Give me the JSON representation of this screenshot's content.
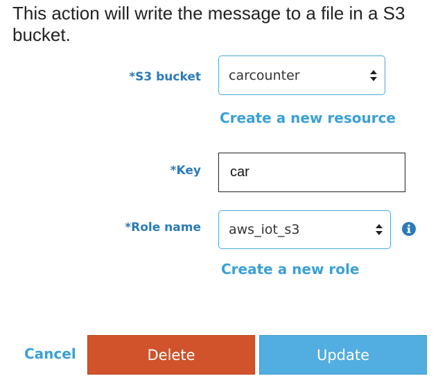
{
  "heading": "This action will write the message to a file in a S3 bucket.",
  "form": {
    "s3_bucket": {
      "label": "*S3 bucket",
      "value": "carcounter",
      "create_link": "Create a new resource"
    },
    "key": {
      "label": "*Key",
      "value": "car"
    },
    "role_name": {
      "label": "*Role name",
      "value": "aws_iot_s3",
      "create_link": "Create a new role"
    }
  },
  "actions": {
    "cancel": "Cancel",
    "delete": "Delete",
    "update": "Update"
  },
  "colors": {
    "label": "#2b7bb9",
    "link": "#3aa0d8",
    "delete_bg": "#d0532b",
    "update_bg": "#52ade0",
    "select_border": "#4aa8d8"
  },
  "icons": {
    "select_arrows": "updown-arrows-icon",
    "info": "info-icon"
  }
}
